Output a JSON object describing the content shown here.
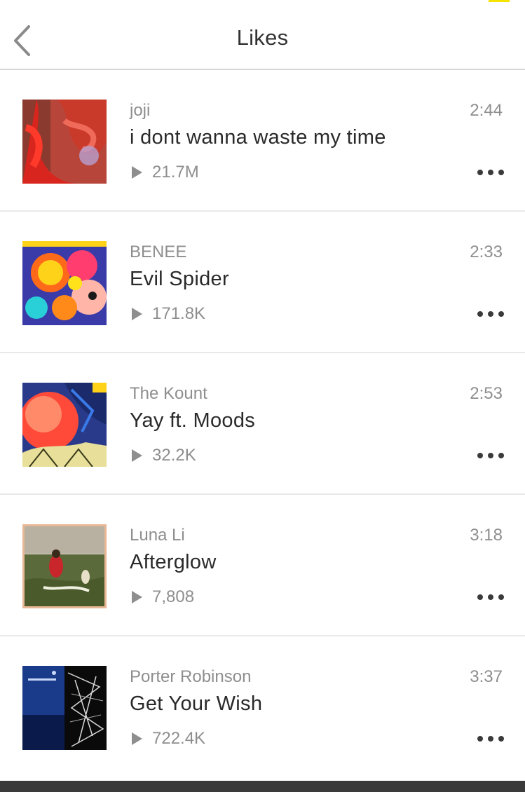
{
  "header": {
    "title": "Likes"
  },
  "tracks": [
    {
      "artist": "joji",
      "title": "i dont wanna waste my time",
      "plays": "21.7M",
      "duration": "2:44"
    },
    {
      "artist": "BENEE",
      "title": "Evil Spider",
      "plays": "171.8K",
      "duration": "2:33"
    },
    {
      "artist": "The Kount",
      "title": "Yay ft. Moods",
      "plays": "32.2K",
      "duration": "2:53"
    },
    {
      "artist": "Luna Li",
      "title": "Afterglow",
      "plays": "7,808",
      "duration": "3:18"
    },
    {
      "artist": "Porter Robinson",
      "title": "Get Your Wish",
      "plays": "722.4K",
      "duration": "3:37"
    }
  ]
}
